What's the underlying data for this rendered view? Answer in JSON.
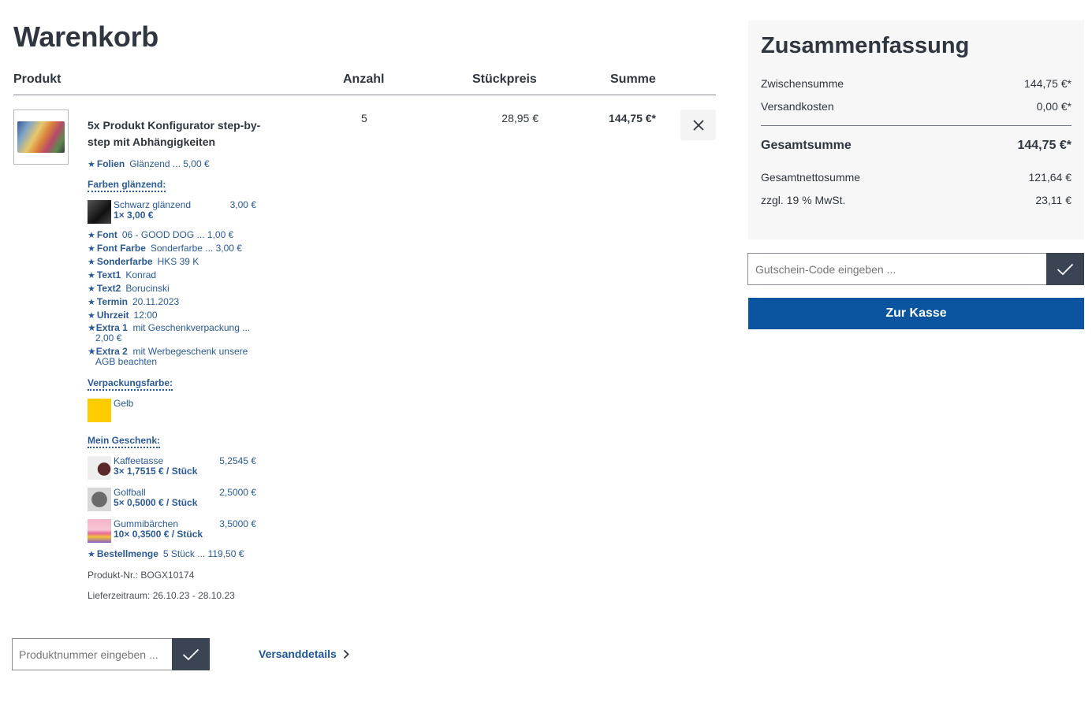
{
  "page": {
    "title": "Warenkorb"
  },
  "cart_header": {
    "product": "Produkt",
    "quantity": "Anzahl",
    "unit_price": "Stückpreis",
    "total": "Summe"
  },
  "item": {
    "title": "5x Produkt Konfigurator step-by-step mit Abhängigkeiten",
    "quantity": "5",
    "unit_price": "28,95 €",
    "total": "144,75 €*",
    "options": {
      "folien": {
        "name": "Folien",
        "value": "Glänzend ... 5,00 €"
      },
      "farben_title": "Farben glänzend:",
      "farben_item": {
        "name": "Schwarz glänzend",
        "price": "3,00 €",
        "qty": "1× 3,00 €",
        "color": "#222222"
      },
      "font": {
        "name": "Font",
        "value": "06 - GOOD DOG ... 1,00 €"
      },
      "font_farbe": {
        "name": "Font Farbe",
        "value": "Sonderfarbe ... 3,00 €"
      },
      "sonderfarbe": {
        "name": "Sonderfarbe",
        "value": "HKS 39 K"
      },
      "text1": {
        "name": "Text1",
        "value": "Konrad"
      },
      "text2": {
        "name": "Text2",
        "value": "Borucinski"
      },
      "termin": {
        "name": "Termin",
        "value": "20.11.2023"
      },
      "uhrzeit": {
        "name": "Uhrzeit",
        "value": "12:00"
      },
      "extra1": {
        "name": "Extra 1",
        "value": "mit Geschenkverpackung ...",
        "value2": "2,00 €"
      },
      "extra2": {
        "name": "Extra 2",
        "value": "mit Werbegeschenk unsere",
        "value2": "AGB beachten"
      },
      "verpackung_title": "Verpackungsfarbe:",
      "verpackung_item": {
        "name": "Gelb",
        "color": "#ffcc00"
      },
      "geschenk_title": "Mein Geschenk:",
      "geschenke": [
        {
          "name": "Kaffeetasse",
          "price": "5,2545 €",
          "qty": "3× 1,7515 € / Stück"
        },
        {
          "name": "Golfball",
          "price": "2,5000 €",
          "qty": "5× 0,5000 € / Stück"
        },
        {
          "name": "Gummibärchen",
          "price": "3,5000 €",
          "qty": "10× 0,3500 € / Stück"
        }
      ],
      "bestellmenge": {
        "name": "Bestellmenge",
        "value": "5 Stück ... 119,50 €"
      }
    },
    "product_number": "Produkt-Nr.: BOGX10174",
    "delivery": "Lieferzeitraum: 26.10.23 - 28.10.23"
  },
  "product_entry": {
    "placeholder": "Produktnummer eingeben ..."
  },
  "shipping_link": "Versanddetails",
  "summary": {
    "title": "Zusammenfassung",
    "subtotal_label": "Zwischensumme",
    "subtotal": "144,75 €*",
    "shipping_label": "Versandkosten",
    "shipping": "0,00 €*",
    "total_label": "Gesamtsumme",
    "total": "144,75 €*",
    "net_label": "Gesamtnettosumme",
    "net": "121,64 €",
    "tax_label": "zzgl. 19 % MwSt.",
    "tax": "23,11 €"
  },
  "voucher": {
    "placeholder": "Gutschein-Code eingeben ..."
  },
  "checkout": {
    "label": "Zur Kasse"
  },
  "colors": {
    "accent": "#0b55a0",
    "link": "#2a5a96",
    "button_dark": "#3b4452"
  }
}
